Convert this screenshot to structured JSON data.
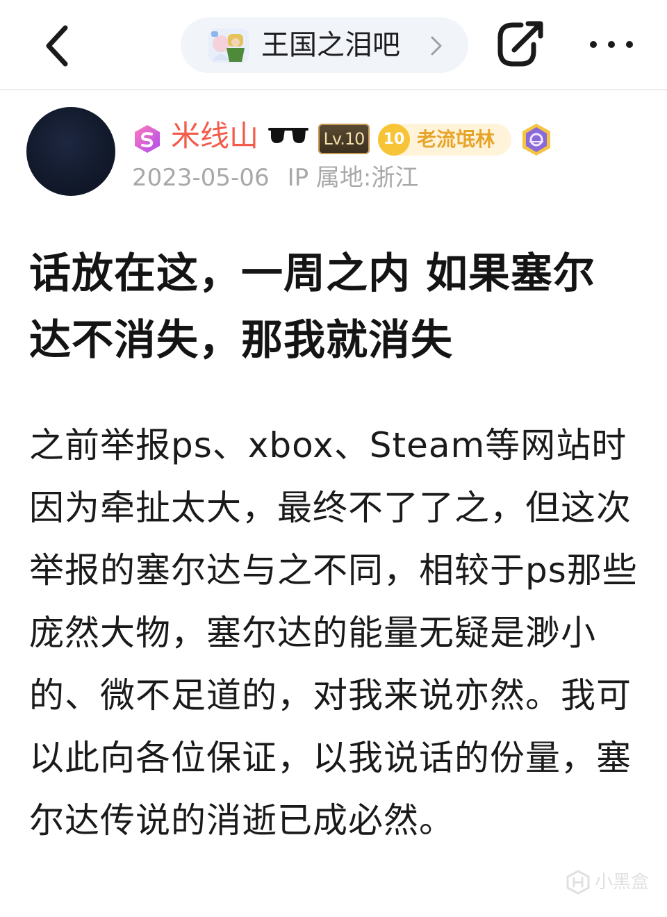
{
  "nav": {
    "forum_name": "王国之泪吧",
    "back_icon": "chevron-left-icon",
    "share_icon": "share-icon",
    "more_icon": "more-icon"
  },
  "author": {
    "name": "米线山",
    "level": "Lv.10",
    "title_level": "10",
    "title": "老流氓林",
    "date": "2023-05-06",
    "ip": "IP 属地:浙江",
    "name_color": "#f25c4a"
  },
  "post": {
    "title": "话放在这，一周之内 如果塞尔达不消失，那我就消失",
    "body": "之前举报ps、xbox、Steam等网站时因为牵扯太大，最终不了了之，但这次举报的塞尔达与之不同，相较于ps那些庞然大物，塞尔达的能量无疑是渺小的、微不足道的，对我来说亦然。我可以此向各位保证，以我说话的份量，塞尔达传说的消逝已成必然。"
  },
  "watermark": {
    "text": "小黑盒"
  }
}
